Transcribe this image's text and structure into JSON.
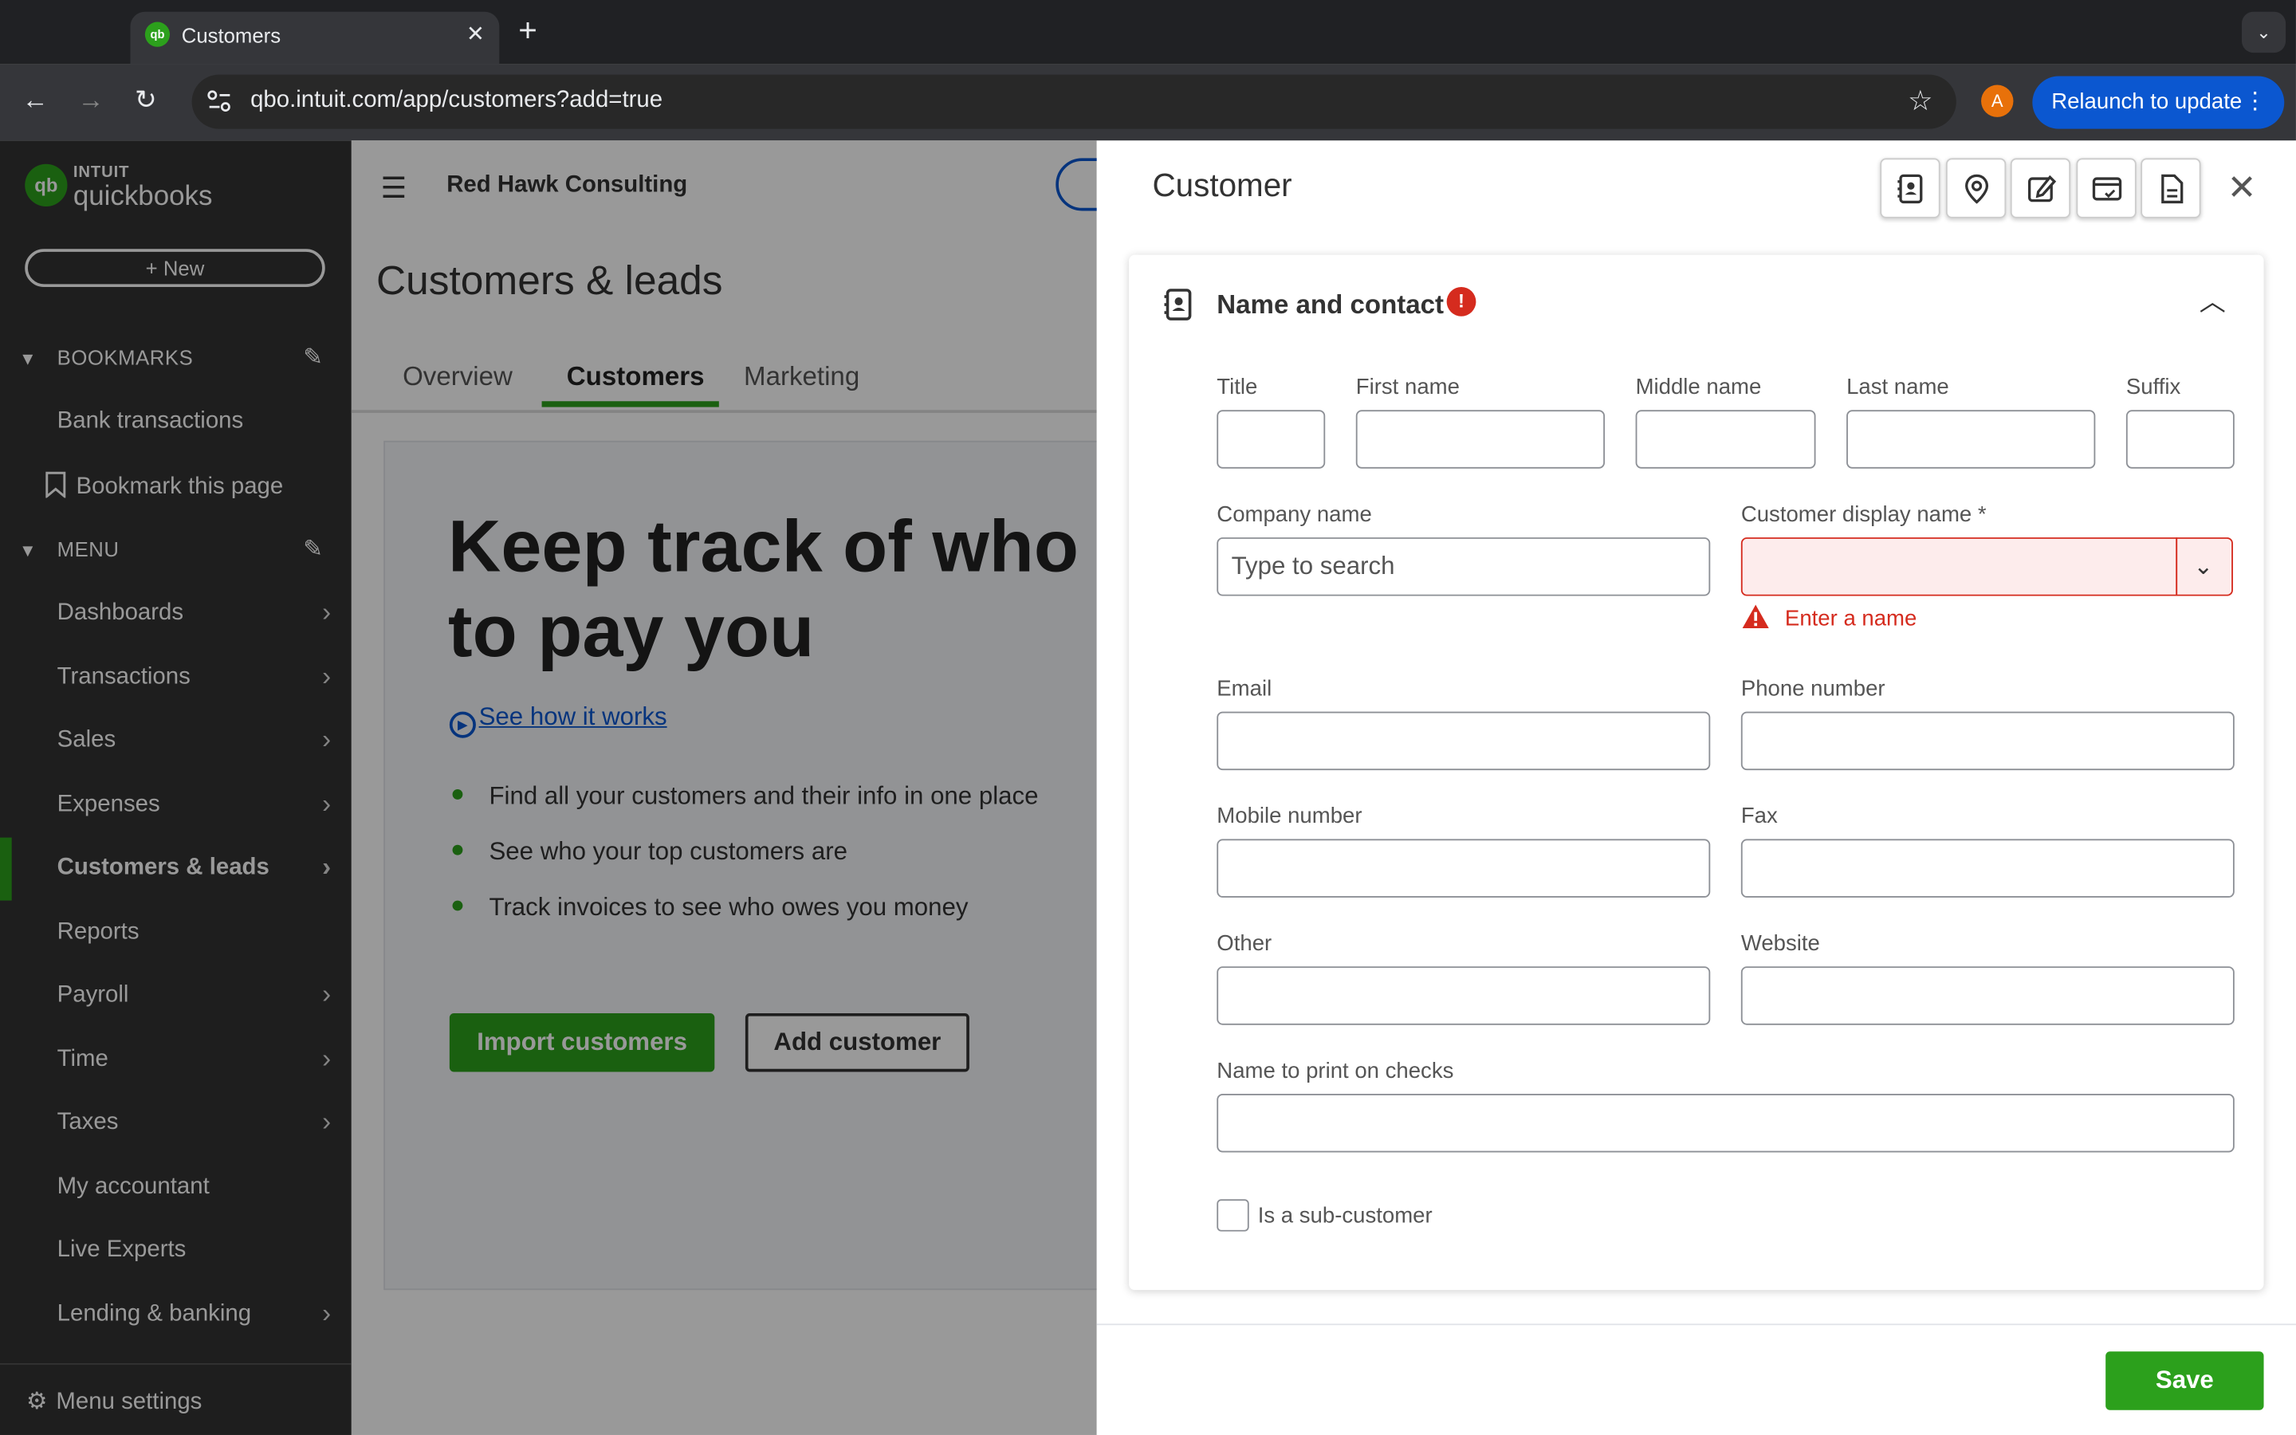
{
  "browser": {
    "tab_title": "Customers",
    "url": "qbo.intuit.com/app/customers?add=true",
    "relaunch_label": "Relaunch to update",
    "profile_initial": "A"
  },
  "sidebar": {
    "logo_intuit": "INTUIT",
    "logo_brand": "quickbooks",
    "new_label": "New",
    "bookmarks_header": "BOOKMARKS",
    "bookmark_items": [
      "Bank transactions",
      "Bookmark this page"
    ],
    "menu_header": "MENU",
    "menu_items": [
      {
        "label": "Dashboards"
      },
      {
        "label": "Transactions"
      },
      {
        "label": "Sales"
      },
      {
        "label": "Expenses"
      },
      {
        "label": "Customers & leads"
      },
      {
        "label": "Reports"
      },
      {
        "label": "Payroll"
      },
      {
        "label": "Time"
      },
      {
        "label": "Taxes"
      },
      {
        "label": "My accountant"
      },
      {
        "label": "Live Experts"
      },
      {
        "label": "Lending & banking"
      }
    ],
    "menu_settings_label": "Menu settings"
  },
  "main": {
    "company_name": "Red Hawk Consulting",
    "page_title": "Customers & leads",
    "tabs": [
      "Overview",
      "Customers",
      "Marketing"
    ],
    "headline_line1": "Keep track of who n",
    "headline_line2": "to pay you",
    "see_how_label": "See how it works",
    "bullets": [
      "Find all your customers and their info in one place",
      "See who your top customers are",
      "Track invoices to see who owes you money"
    ],
    "import_label": "Import customers",
    "add_label": "Add customer"
  },
  "drawer": {
    "title": "Customer",
    "section_title": "Name and contact",
    "fields": {
      "title_label": "Title",
      "first_name_label": "First name",
      "middle_name_label": "Middle name",
      "last_name_label": "Last name",
      "suffix_label": "Suffix",
      "company_label": "Company name",
      "company_placeholder": "Type to search",
      "display_name_label": "Customer display name *",
      "display_name_error": "Enter a name",
      "email_label": "Email",
      "phone_label": "Phone number",
      "mobile_label": "Mobile number",
      "fax_label": "Fax",
      "other_label": "Other",
      "website_label": "Website",
      "print_name_label": "Name to print on checks",
      "subcustomer_label": "Is a sub-customer"
    },
    "save_label": "Save"
  },
  "colors": {
    "brand_green": "#2ca01c",
    "error_red": "#d52b1e",
    "sidebar_bg": "#333333"
  }
}
